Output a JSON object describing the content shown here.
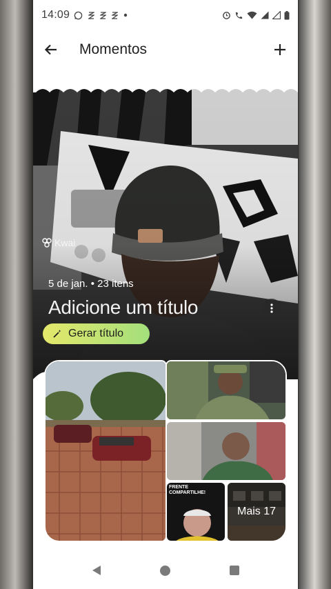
{
  "status_bar": {
    "time": "14:09",
    "left_icons": [
      "whatsapp-icon",
      "notification-icon",
      "notification-icon",
      "notification-icon",
      "dot-icon"
    ],
    "right_icons": [
      "alarm-icon",
      "call-icon",
      "wifi-icon",
      "signal-icon",
      "signal-icon",
      "battery-icon"
    ]
  },
  "app_bar": {
    "title": "Momentos",
    "back_icon": "arrow-back-icon",
    "add_icon": "add-icon"
  },
  "hero": {
    "watermark": "Kwai",
    "date_items": "5 de jan. • 23 itens",
    "title_placeholder": "Adicione um título",
    "generate_button": "Gerar título",
    "more_icon": "more-vert-icon"
  },
  "grid": {
    "tile4_caption": "FRENTE\nCOMPARTILHE!",
    "more_label": "Mais 17"
  },
  "nav_bar": {
    "icons": [
      "nav-back-icon",
      "nav-home-icon",
      "nav-recents-icon"
    ]
  },
  "colors": {
    "accent_gradient_start": "#e4e86a",
    "accent_gradient_end": "#a3df7c",
    "background": "#ffffff",
    "text_primary": "#1f1f1f"
  }
}
